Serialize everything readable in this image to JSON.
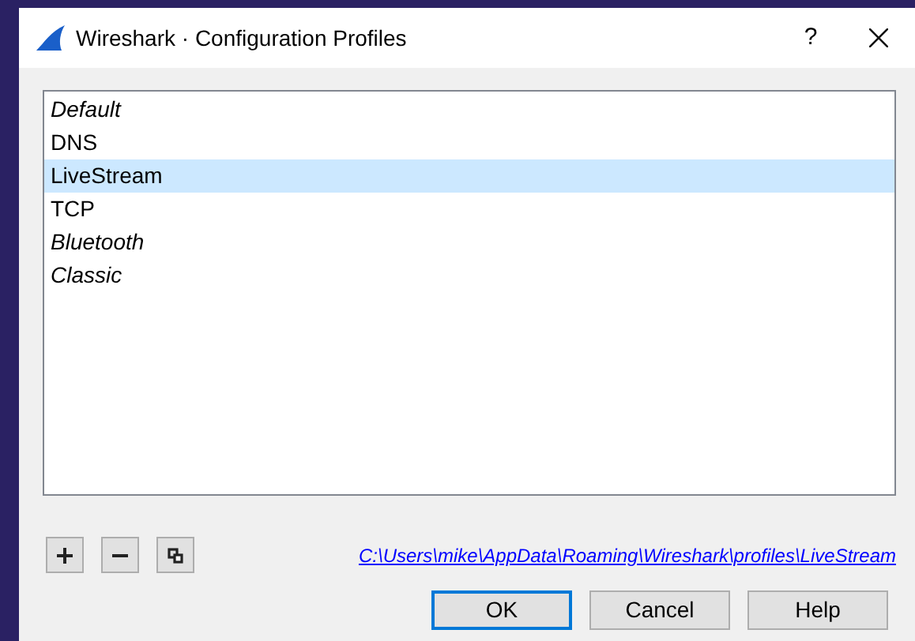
{
  "window": {
    "title": "Wireshark · Configuration Profiles",
    "help": "?"
  },
  "profiles": [
    {
      "name": "Default",
      "kind": "global",
      "selected": false
    },
    {
      "name": "DNS",
      "kind": "user",
      "selected": false
    },
    {
      "name": "LiveStream",
      "kind": "user",
      "selected": true
    },
    {
      "name": "TCP",
      "kind": "user",
      "selected": false
    },
    {
      "name": "Bluetooth",
      "kind": "global",
      "selected": false
    },
    {
      "name": "Classic",
      "kind": "global",
      "selected": false
    }
  ],
  "tools": [
    {
      "kind": "add"
    },
    {
      "kind": "remove"
    },
    {
      "kind": "copy"
    }
  ],
  "path_link": "C:\\Users\\mike\\AppData\\Roaming\\Wireshark\\profiles\\LiveStream",
  "buttons": [
    {
      "label": "OK",
      "default": true
    },
    {
      "label": "Cancel",
      "default": false
    },
    {
      "label": "Help",
      "default": false
    }
  ]
}
